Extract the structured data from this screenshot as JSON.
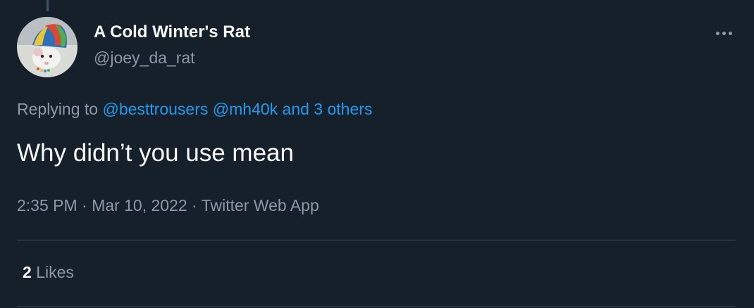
{
  "author": {
    "display_name": "A Cold Winter's Rat",
    "handle": "@joey_da_rat",
    "avatar_icon": "rat-in-striped-hat-avatar"
  },
  "reply": {
    "prefix": "Replying to",
    "mentions": [
      "@besttrousers",
      "@mh40k"
    ],
    "others": "and 3 others"
  },
  "tweet": {
    "text": "Why didn’t you use mean"
  },
  "meta": {
    "time": "2:35 PM",
    "separator": "·",
    "date": "Mar 10, 2022",
    "source": "Twitter Web App"
  },
  "stats": {
    "likes_count": "2",
    "likes_label": "Likes"
  },
  "colors": {
    "background": "#15202b",
    "text_primary": "#f7f9f9",
    "text_secondary": "#8b98a5",
    "link": "#1d9bf0",
    "divider": "#38444d"
  },
  "icons": {
    "more": "more-horizontal-icon"
  }
}
